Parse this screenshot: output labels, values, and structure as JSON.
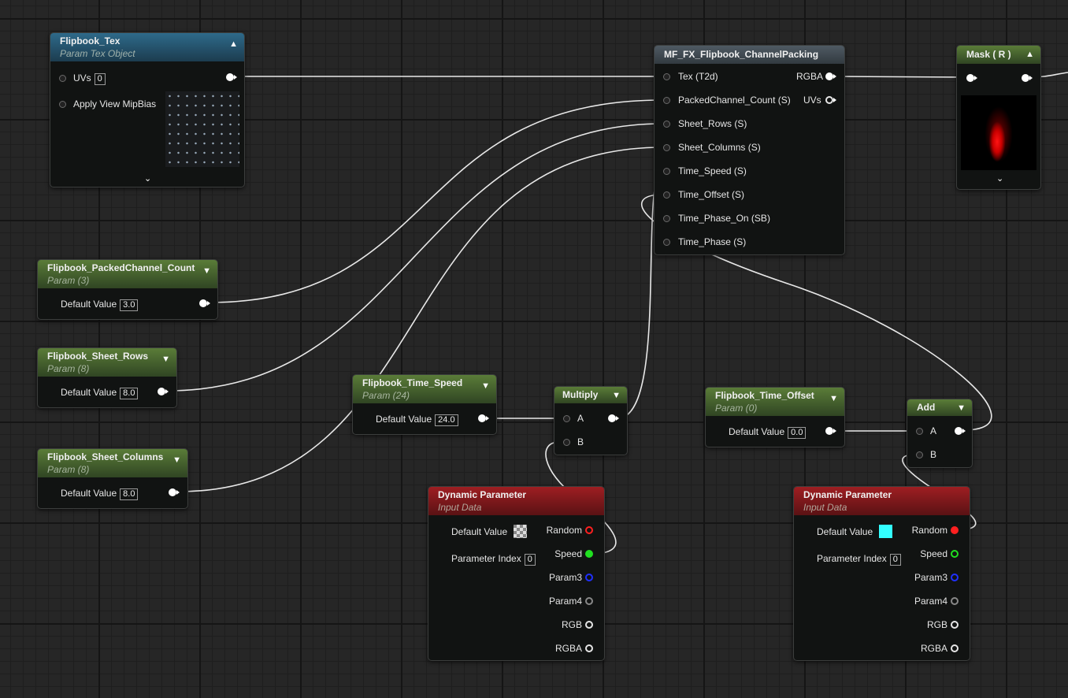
{
  "nodes": {
    "flipbook_tex": {
      "title": "Flipbook_Tex",
      "subtitle": "Param Tex Object",
      "uvs_label": "UVs",
      "uvs_value": "0",
      "mipbias_label": "Apply View MipBias"
    },
    "channel_packing": {
      "title": "MF_FX_Flipbook_ChannelPacking",
      "inputs": [
        "Tex (T2d)",
        "PackedChannel_Count (S)",
        "Sheet_Rows (S)",
        "Sheet_Columns (S)",
        "Time_Speed (S)",
        "Time_Offset (S)",
        "Time_Phase_On (SB)",
        "Time_Phase (S)"
      ],
      "outputs": [
        "RGBA",
        "UVs"
      ]
    },
    "mask": {
      "title": "Mask ( R )"
    },
    "packed_count": {
      "title": "Flipbook_PackedChannel_Count",
      "subtitle": "Param (3)",
      "label": "Default Value",
      "value": "3.0"
    },
    "sheet_rows": {
      "title": "Flipbook_Sheet_Rows",
      "subtitle": "Param (8)",
      "label": "Default Value",
      "value": "8.0"
    },
    "sheet_columns": {
      "title": "Flipbook_Sheet_Columns",
      "subtitle": "Param (8)",
      "label": "Default Value",
      "value": "8.0"
    },
    "time_speed": {
      "title": "Flipbook_Time_Speed",
      "subtitle": "Param (24)",
      "label": "Default Value",
      "value": "24.0"
    },
    "multiply": {
      "title": "Multiply",
      "a": "A",
      "b": "B"
    },
    "time_offset": {
      "title": "Flipbook_Time_Offset",
      "subtitle": "Param (0)",
      "label": "Default Value",
      "value": "0.0"
    },
    "add": {
      "title": "Add",
      "a": "A",
      "b": "B"
    },
    "dyn1": {
      "title": "Dynamic Parameter",
      "subtitle": "Input Data",
      "default_label": "Default Value",
      "index_label": "Parameter Index",
      "index_value": "0",
      "outputs": [
        "Random",
        "Speed",
        "Param3",
        "Param4",
        "RGB",
        "RGBA"
      ]
    },
    "dyn2": {
      "title": "Dynamic Parameter",
      "subtitle": "Input Data",
      "default_label": "Default Value",
      "index_label": "Parameter Index",
      "index_value": "0",
      "outputs": [
        "Random",
        "Speed",
        "Param3",
        "Param4",
        "RGB",
        "RGBA"
      ]
    }
  },
  "colors": {
    "wire": "#e8e8e8",
    "random": "#ff2020",
    "speed": "#20e020",
    "param3": "#2030ff",
    "cyan_default": "#33ffff"
  }
}
